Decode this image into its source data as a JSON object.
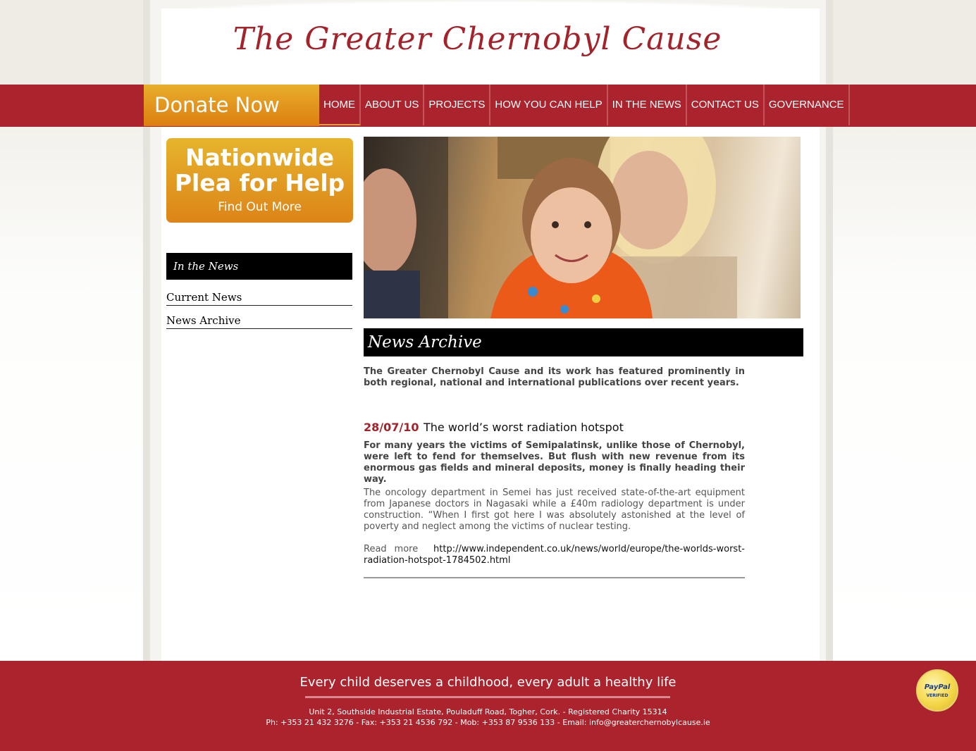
{
  "site": {
    "title": "The Greater Chernobyl Cause"
  },
  "nav": {
    "donate_label": "Donate Now",
    "items": [
      {
        "label": "HOME"
      },
      {
        "label": "ABOUT US"
      },
      {
        "label": "PROJECTS"
      },
      {
        "label": "HOW YOU CAN HELP"
      },
      {
        "label": "IN THE NEWS"
      },
      {
        "label": "CONTACT US"
      },
      {
        "label": "GOVERNANCE"
      }
    ],
    "active": "HOME"
  },
  "sidebar": {
    "promo": {
      "line1": "Nationwide",
      "line2": "Plea for Help",
      "sub": "Find Out More"
    },
    "section_title": "In the News",
    "links": [
      {
        "label": "Current News"
      },
      {
        "label": "News Archive"
      }
    ]
  },
  "main": {
    "heading": "News Archive",
    "intro": "The Greater Chernobyl Cause and its work has featured prominently in both regional, national and international publications over recent years.",
    "article": {
      "date": "28/07/10",
      "title": "The world’s worst radiation hotspot",
      "lead": "For many years the victims of Semipalatinsk, unlike those of Chernobyl, were left to fend for themselves. But flush with new revenue from its enormous gas fields and mineral deposits, money is finally heading their way.",
      "body": "The oncology department in Semei has just received state-of-the-art equipment from Japanese doctors in Nagasaki while a £40m radiology department is under construction. “When I first got here I was absolutely astonished at the level of poverty and neglect among the victims of nuclear testing.",
      "read_more_label": "Read more",
      "link": "http://www.independent.co.uk/news/world/europe/the-worlds-worst-radiation-hotspot-1784502.html"
    }
  },
  "footer": {
    "slogan": "Every child deserves a childhood, every adult a healthy life",
    "address": "Unit 2, Southside Industrial Estate, Pouladuff Road, Togher, Cork. - Registered Charity 15314",
    "contact": "Ph: +353 21 432 3276 - Fax: +353 21 4536 792 - Mob: +353 87 9536 133 - Email: info@greaterchernobylcause.ie",
    "badge": {
      "brand": "PayPal",
      "sub": "VERIFIED"
    }
  },
  "colors": {
    "brand_red": "#ab232c",
    "title_red": "#a3232b",
    "donate_orange": "#e39a20"
  }
}
